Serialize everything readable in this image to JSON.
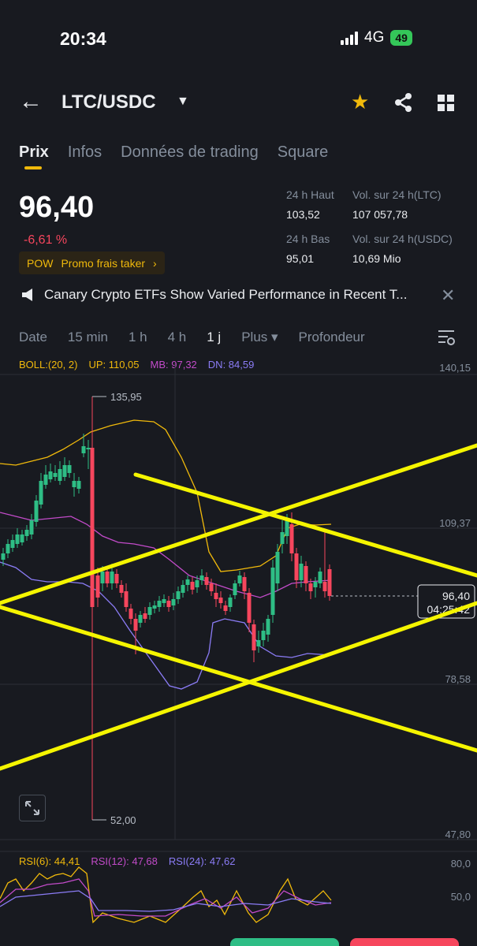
{
  "status": {
    "time": "20:34",
    "network": "4G",
    "battery": "49"
  },
  "header": {
    "pair": "LTC/USDC"
  },
  "tabs": [
    "Prix",
    "Infos",
    "Données de trading",
    "Square"
  ],
  "ticker": {
    "price": "96,40",
    "change": "-6,61 %",
    "promo_tag": "POW",
    "promo_text": "Promo frais taker",
    "high_label": "24 h Haut",
    "high": "103,52",
    "low_label": "24 h Bas",
    "low": "95,01",
    "vol_ltc_label": "Vol. sur 24 h(LTC)",
    "vol_ltc": "107 057,78",
    "vol_usdc_label": "Vol. sur 24 h(USDC)",
    "vol_usdc": "10,69 Mio"
  },
  "news": {
    "text": "Canary Crypto ETFs Show Varied Performance in Recent T..."
  },
  "timeframes": [
    "Date",
    "15 min",
    "1 h",
    "4 h",
    "1 j",
    "Plus",
    "Profondeur"
  ],
  "active_timeframe": "1 j",
  "boll": {
    "label": "BOLL:(20, 2)",
    "up": "UP: 110,05",
    "mb": "MB: 97,32",
    "dn": "DN: 84,59"
  },
  "price_axis": [
    "140,15",
    "109,37",
    "78,58",
    "47,80"
  ],
  "chart_labels": {
    "high": "135,95",
    "low": "52,00"
  },
  "current_price_tag": {
    "price": "96,40",
    "countdown": "04:25:42"
  },
  "rsi": {
    "r6": "RSI(6): 44,41",
    "r12": "RSI(12): 47,68",
    "r24": "RSI(24): 47,62",
    "axis": [
      "80,0",
      "50,0"
    ]
  },
  "colors": {
    "up": "#2ebd85",
    "down": "#f6465d",
    "accent": "#f0b90b",
    "trendline": "#f5f500",
    "boll_up": "#f0b90b",
    "boll_mb": "#c24bc9",
    "boll_dn": "#8b7cf6"
  }
}
